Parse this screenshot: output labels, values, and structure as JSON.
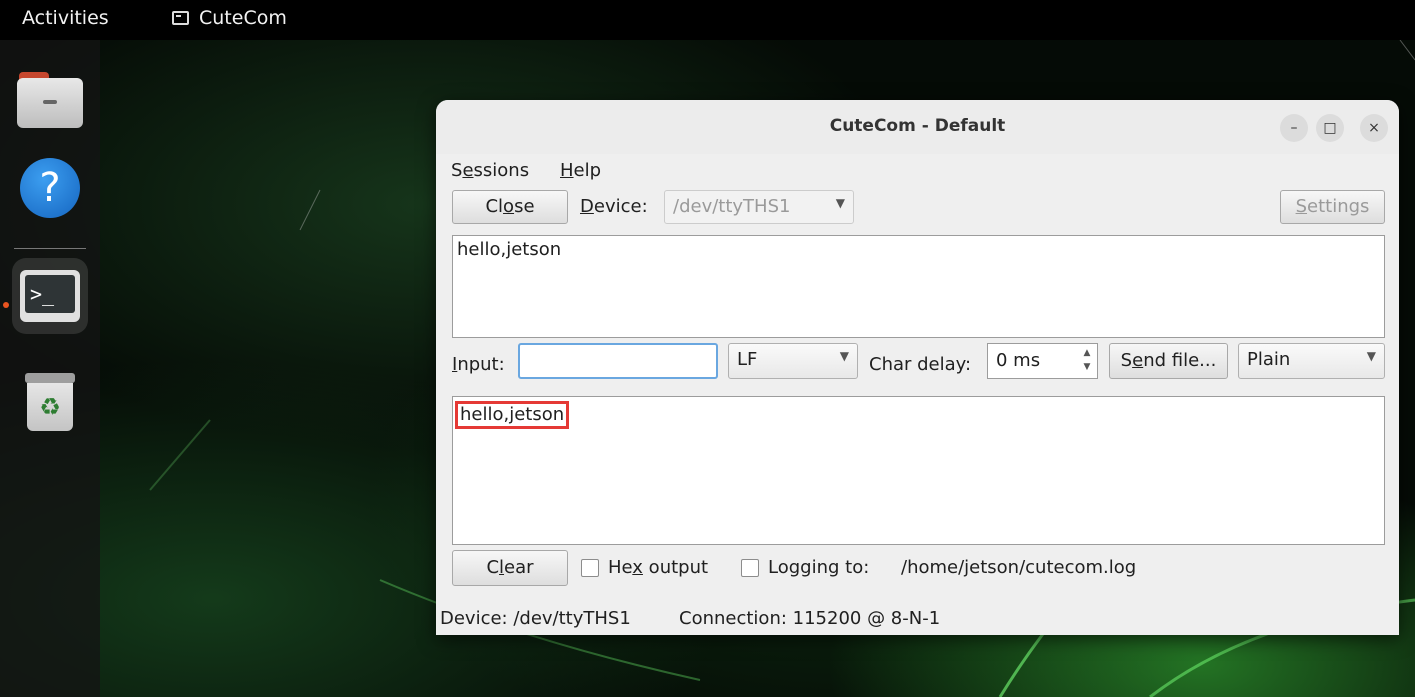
{
  "topbar": {
    "activities": "Activities",
    "app_name": "CuteCom"
  },
  "dock": {
    "items": [
      {
        "name": "Files",
        "icon": "files-icon"
      },
      {
        "name": "Help",
        "icon": "help-icon",
        "glyph": "?"
      },
      {
        "name": "Terminal",
        "icon": "terminal-icon",
        "glyph": ">_",
        "running": true
      },
      {
        "name": "Trash",
        "icon": "trash-icon",
        "glyph": "♻"
      }
    ]
  },
  "window": {
    "title": "CuteCom - Default",
    "controls": {
      "minimize": "–",
      "maximize": "□",
      "close": "×"
    },
    "menu": {
      "sessions": {
        "pre": "S",
        "u": "e",
        "post": "ssions"
      },
      "help": {
        "pre": "",
        "u": "H",
        "post": "elp"
      }
    },
    "toolbar": {
      "close_button": {
        "pre": "Cl",
        "u": "o",
        "post": "se"
      },
      "device_label": {
        "pre": "",
        "u": "D",
        "post": "evice:"
      },
      "device_value": "/dev/ttyTHS1",
      "settings_button": {
        "pre": "",
        "u": "S",
        "post": "ettings"
      }
    },
    "output_text": "hello,jetson",
    "input_row": {
      "input_label": {
        "pre": "",
        "u": "I",
        "post": "nput:"
      },
      "input_value": "",
      "line_ending": "LF",
      "char_delay_label": "Char delay:",
      "char_delay_value": "0 ms",
      "send_file_button": {
        "pre": "S",
        "u": "e",
        "post": "nd file..."
      },
      "format": "Plain"
    },
    "log_text": "hello,jetson",
    "highlight_color": "#e53935",
    "bottom_row": {
      "clear_button": {
        "pre": "C",
        "u": "l",
        "post": "ear"
      },
      "hex_output": {
        "pre": "He",
        "u": "x",
        "post": " output"
      },
      "logging_label": "Logging to:",
      "log_path": "/home/jetson/cutecom.log"
    },
    "status": {
      "device": "Device:  /dev/ttyTHS1",
      "connection": "Connection:  115200 @ 8-N-1"
    }
  }
}
